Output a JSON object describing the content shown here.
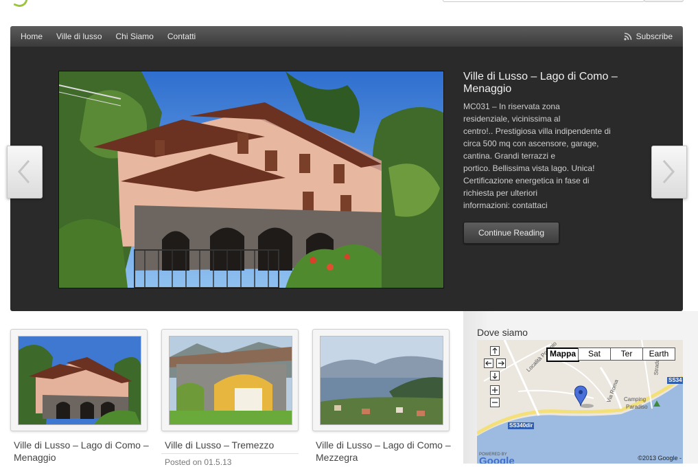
{
  "nav": {
    "items": [
      "Home",
      "Ville di lusso",
      "Chi Siamo",
      "Contatti"
    ],
    "subscribe": "Subscribe"
  },
  "slider": {
    "title": "Ville di Lusso – Lago di Como – Menaggio",
    "lines": [
      "MC031 – In riservata zona",
      "residenziale, vicinissima al",
      "centro!.. Prestigiosa villa indipendente di",
      "circa 500 mq con ascensore, garage,",
      "cantina. Grandi terrazzi e",
      "portico. Bellissima vista lago. Unica!",
      "Certificazione energetica in fase di",
      "richiesta per ulteriori",
      "informazioni: contattaci"
    ],
    "button": "Continue Reading"
  },
  "posts": [
    {
      "title": "Ville di Lusso – Lago di Como – Menaggio"
    },
    {
      "title": "Ville di Lusso – Tremezzo",
      "meta": "Posted on 01.5.13"
    },
    {
      "title": "Ville di Lusso – Lago di Como – Mezzegra"
    }
  ],
  "sidebar": {
    "title": "Dove siamo",
    "map": {
      "types": [
        "Mappa",
        "Sat",
        "Ter",
        "Earth"
      ],
      "labels": [
        "Località Pozzolo",
        "Via Roma",
        "Strada",
        "Camping",
        "Paradiso",
        "SS340dir",
        "SS34"
      ],
      "powered": "POWERED BY",
      "google": "Google",
      "copyright": "©2013 Google -"
    }
  }
}
